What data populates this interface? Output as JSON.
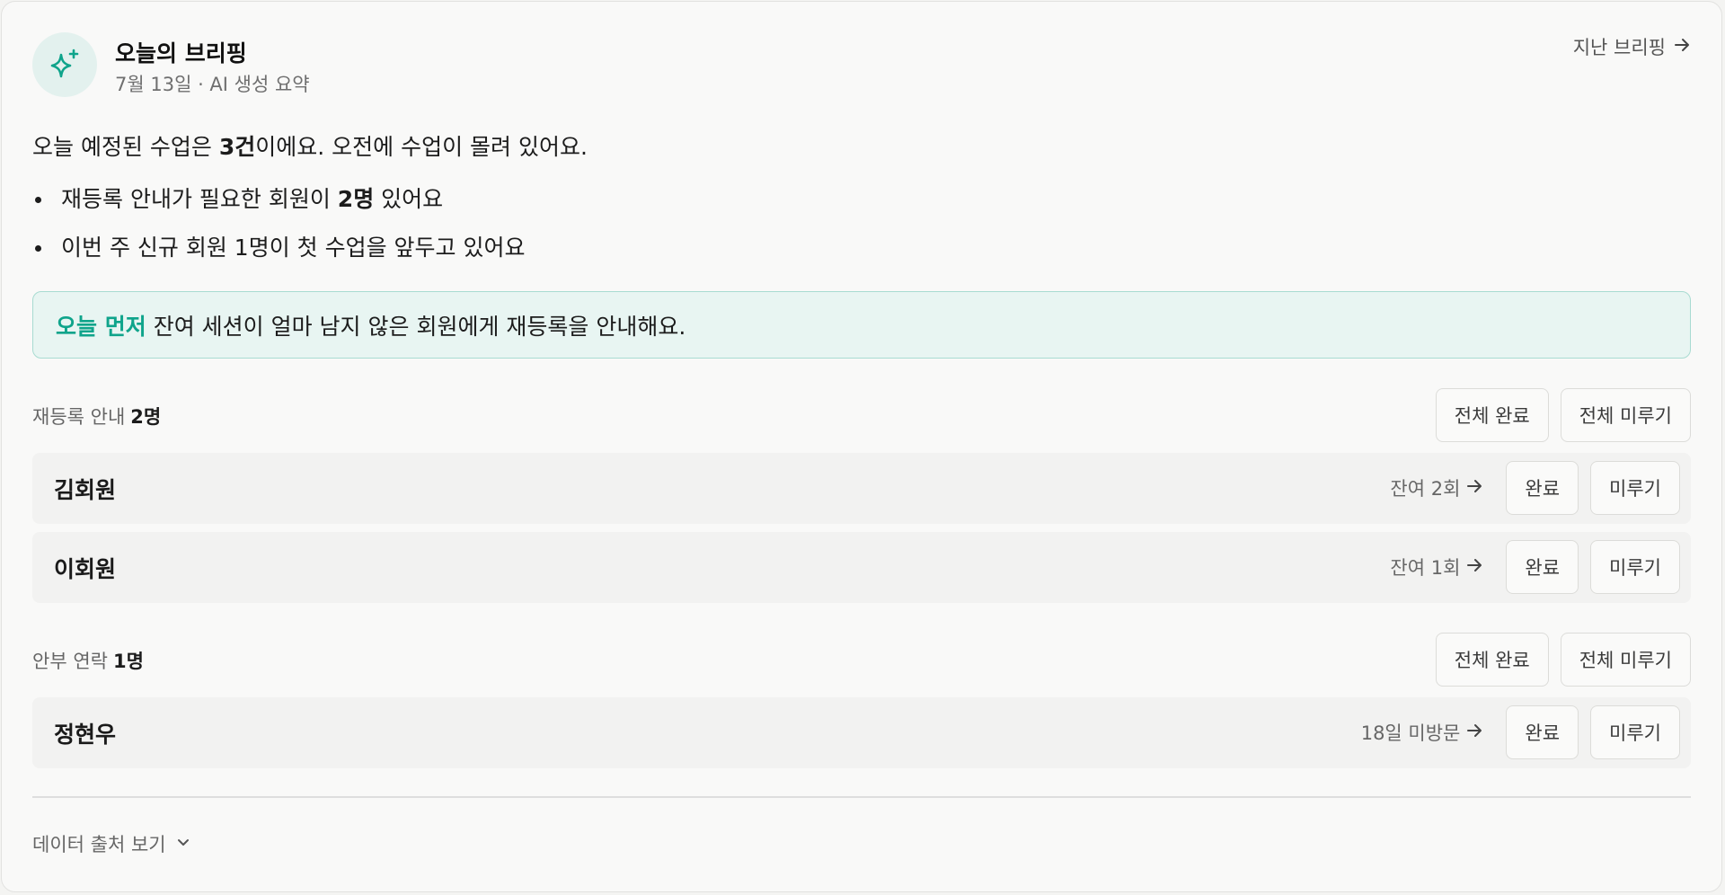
{
  "header": {
    "title": "오늘의 브리핑",
    "subtitle": "7월 13일 · AI 생성 요약",
    "past_link": "지난 브리핑",
    "icon": "sparkle-icon",
    "accent_color": "#0fa48b"
  },
  "summary": {
    "prefix": "오늘 예정된 수업은 ",
    "count": "3건",
    "suffix": "이에요. 오전에 수업이 몰려 있어요."
  },
  "bullets": [
    {
      "prefix": "재등록 안내가 필요한 회원이 ",
      "bold": "2명",
      "suffix": " 있어요"
    },
    {
      "prefix": "이번 주 신규 회원 1명이 첫 수업을 앞두고 있어요",
      "bold": "",
      "suffix": ""
    }
  ],
  "priority": {
    "label": "오늘 먼저",
    "text": "잔여 세션이 얼마 남지 않은 회원에게 재등록을 안내해요."
  },
  "sections": [
    {
      "title": "재등록 안내",
      "count": "2명",
      "complete_all": "전체 완료",
      "postpone_all": "전체 미루기",
      "members": [
        {
          "name": "김회원",
          "status": "잔여 2회",
          "complete": "완료",
          "postpone": "미루기"
        },
        {
          "name": "이회원",
          "status": "잔여 1회",
          "complete": "완료",
          "postpone": "미루기"
        }
      ]
    },
    {
      "title": "안부 연락",
      "count": "1명",
      "complete_all": "전체 완료",
      "postpone_all": "전체 미루기",
      "members": [
        {
          "name": "정현우",
          "status": "18일 미방문",
          "complete": "완료",
          "postpone": "미루기"
        }
      ]
    }
  ],
  "footer": {
    "source_toggle": "데이터 출처 보기"
  }
}
